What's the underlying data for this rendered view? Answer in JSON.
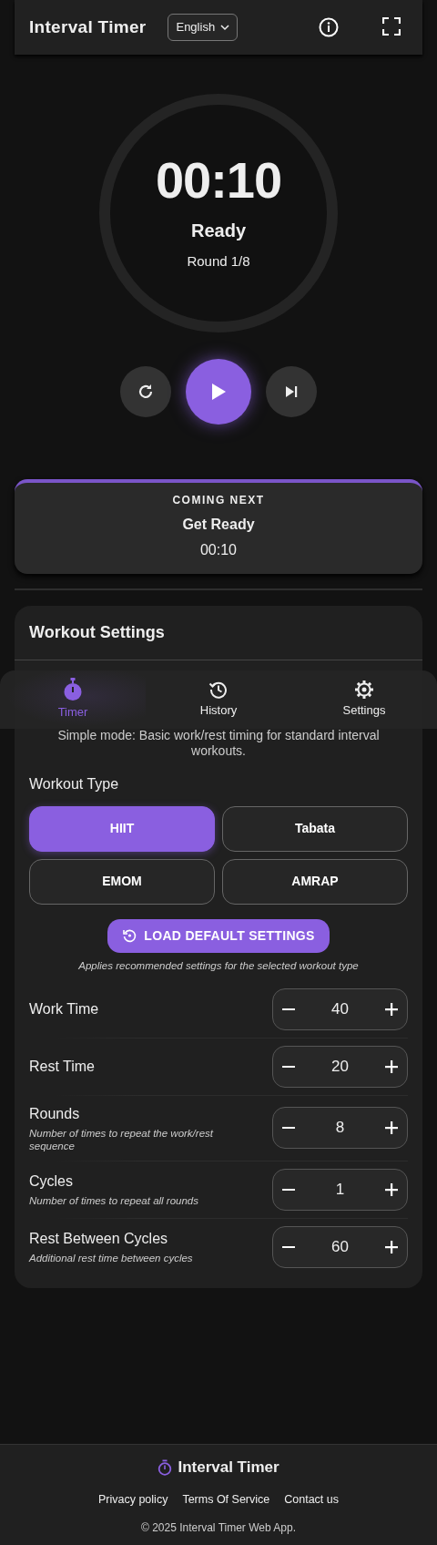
{
  "header": {
    "title": "Interval Timer",
    "language": "English"
  },
  "timer": {
    "time": "00:10",
    "phase": "Ready",
    "round": "Round 1/8"
  },
  "next": {
    "heading": "COMING NEXT",
    "name": "Get Ready",
    "time": "00:10"
  },
  "bottom_nav": [
    {
      "label": "Timer",
      "selected": true
    },
    {
      "label": "History",
      "selected": false
    },
    {
      "label": "Settings",
      "selected": false
    }
  ],
  "settings": {
    "title": "Workout Settings",
    "mode_note": "Simple mode: Basic work/rest timing for standard interval workouts.",
    "type_label": "Workout Type",
    "types": [
      {
        "label": "HIIT",
        "selected": true
      },
      {
        "label": "Tabata",
        "selected": false
      },
      {
        "label": "EMOM",
        "selected": false
      },
      {
        "label": "AMRAP",
        "selected": false
      }
    ],
    "load_button": "LOAD DEFAULT SETTINGS",
    "load_note": "Applies recommended settings for the selected workout type",
    "fields": [
      {
        "label": "Work Time",
        "value": "40"
      },
      {
        "label": "Rest Time",
        "value": "20"
      },
      {
        "label": "Rounds",
        "hint": "Number of times to repeat the work/rest sequence",
        "value": "8"
      },
      {
        "label": "Cycles",
        "hint": "Number of times to repeat all rounds",
        "value": "1"
      },
      {
        "label": "Rest Between Cycles",
        "hint": "Additional rest time between cycles",
        "value": "60"
      }
    ]
  },
  "footer": {
    "brand": "Interval Timer",
    "links": [
      "Privacy policy",
      "Terms Of Service",
      "Contact us"
    ],
    "copyright": "© 2025 Interval Timer Web App."
  }
}
